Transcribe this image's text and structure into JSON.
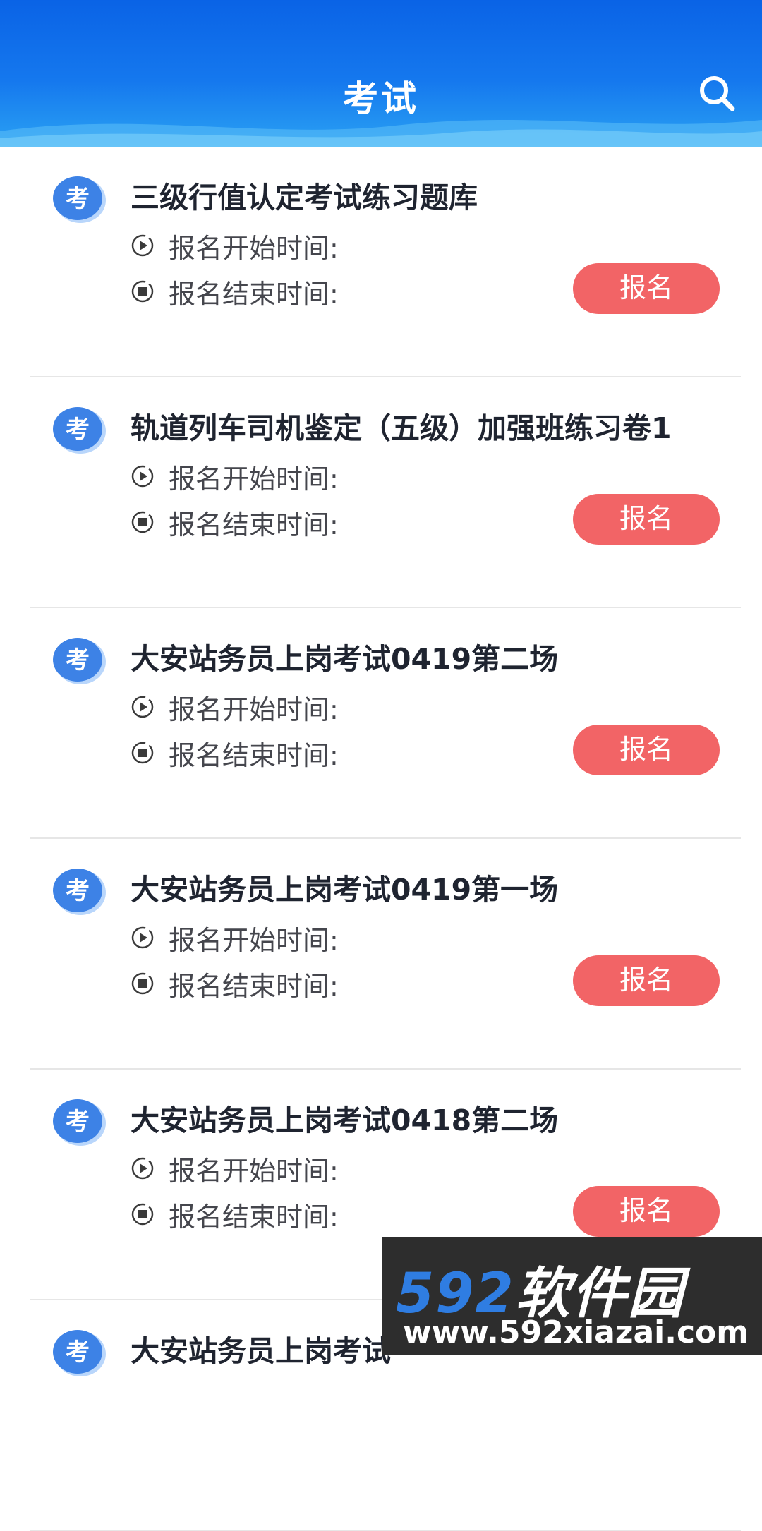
{
  "header": {
    "title": "考试"
  },
  "exams": [
    {
      "title": "三级行值认定考试练习题库",
      "start_label": "报名开始时间:",
      "end_label": "报名结束时间:",
      "badge": "考",
      "button": "报名"
    },
    {
      "title": "轨道列车司机鉴定（五级）加强班练习卷1",
      "start_label": "报名开始时间:",
      "end_label": "报名结束时间:",
      "badge": "考",
      "button": "报名"
    },
    {
      "title": "大安站务员上岗考试0419第二场",
      "start_label": "报名开始时间:",
      "end_label": "报名结束时间:",
      "badge": "考",
      "button": "报名"
    },
    {
      "title": "大安站务员上岗考试0419第一场",
      "start_label": "报名开始时间:",
      "end_label": "报名结束时间:",
      "badge": "考",
      "button": "报名"
    },
    {
      "title": "大安站务员上岗考试0418第二场",
      "start_label": "报名开始时间:",
      "end_label": "报名结束时间:",
      "badge": "考",
      "button": "报名"
    },
    {
      "title": "大安站务员上岗考试",
      "start_label": "",
      "end_label": "",
      "badge": "考",
      "button": ""
    }
  ],
  "watermark": {
    "brand_num": "592",
    "brand_text": "软件园",
    "url": "www.592xiazai.com"
  },
  "colors": {
    "header_blue": "#1578ee",
    "button_red": "#f26466",
    "badge_blue": "#3d82e6"
  },
  "icons": {
    "search": "search-icon",
    "start": "play-circle-icon",
    "end": "stop-circle-icon",
    "badge": "exam-badge-icon"
  }
}
